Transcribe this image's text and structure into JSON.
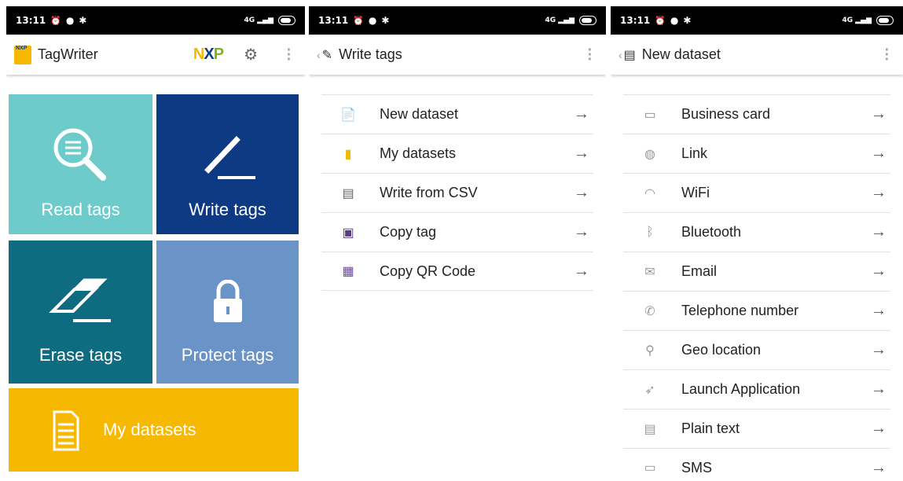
{
  "status": {
    "time": "13:11",
    "network": "4G"
  },
  "home": {
    "app_title": "TagWriter",
    "brand": "NXP",
    "tiles": {
      "read": "Read tags",
      "write": "Write tags",
      "erase": "Erase tags",
      "protect": "Protect tags",
      "datasets": "My datasets"
    },
    "colors": {
      "read": "#6dcbcb",
      "write": "#0d3a82",
      "erase": "#0f6b80",
      "protect": "#6a93c8",
      "datasets": "#f7b800"
    }
  },
  "write_tags": {
    "title": "Write tags",
    "items": [
      {
        "label": "New dataset",
        "icon": "new-dataset-icon"
      },
      {
        "label": "My datasets",
        "icon": "datasets-icon"
      },
      {
        "label": "Write from CSV",
        "icon": "csv-icon"
      },
      {
        "label": "Copy tag",
        "icon": "copy-tag-icon"
      },
      {
        "label": "Copy QR Code",
        "icon": "qr-code-icon"
      }
    ]
  },
  "new_dataset": {
    "title": "New dataset",
    "items": [
      {
        "label": "Business card",
        "icon": "business-card-icon"
      },
      {
        "label": "Link",
        "icon": "globe-icon"
      },
      {
        "label": "WiFi",
        "icon": "wifi-icon"
      },
      {
        "label": "Bluetooth",
        "icon": "bluetooth-icon"
      },
      {
        "label": "Email",
        "icon": "email-icon"
      },
      {
        "label": "Telephone number",
        "icon": "phone-icon"
      },
      {
        "label": "Geo location",
        "icon": "location-pin-icon"
      },
      {
        "label": "Launch Application",
        "icon": "rocket-icon"
      },
      {
        "label": "Plain text",
        "icon": "text-document-icon"
      },
      {
        "label": "SMS",
        "icon": "sms-icon"
      }
    ]
  }
}
